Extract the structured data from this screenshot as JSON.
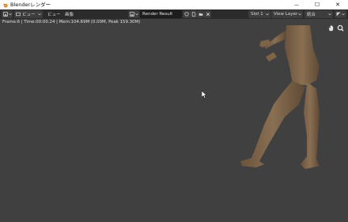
{
  "window": {
    "title": "Blenderレンダー",
    "minimize_glyph": "—",
    "maximize_glyph": "☐",
    "close_glyph": "✕"
  },
  "header": {
    "menus": [
      "ビュー",
      "画像"
    ],
    "image_name": "Render Result",
    "slot": "Slot 1",
    "view_layer": "View Layer",
    "combined": "統合"
  },
  "info": {
    "text": "Frame:6 | Time:00:00.24 | Mem:104.69M (0.00M, Peak 159.30M)"
  },
  "colors": {
    "viewport_bg": "#404040",
    "header_bg": "#2b2b2b",
    "figure_skin": "#7a6248"
  },
  "icons": [
    "blender-logo-icon",
    "editor-type-icon",
    "chevron-down-icon",
    "image-browse-icon",
    "shield-icon",
    "new-image-icon",
    "open-image-icon",
    "close-icon",
    "hand-pan-icon",
    "zoom-icon",
    "display-channels-icon",
    "mouse-cursor-icon"
  ]
}
